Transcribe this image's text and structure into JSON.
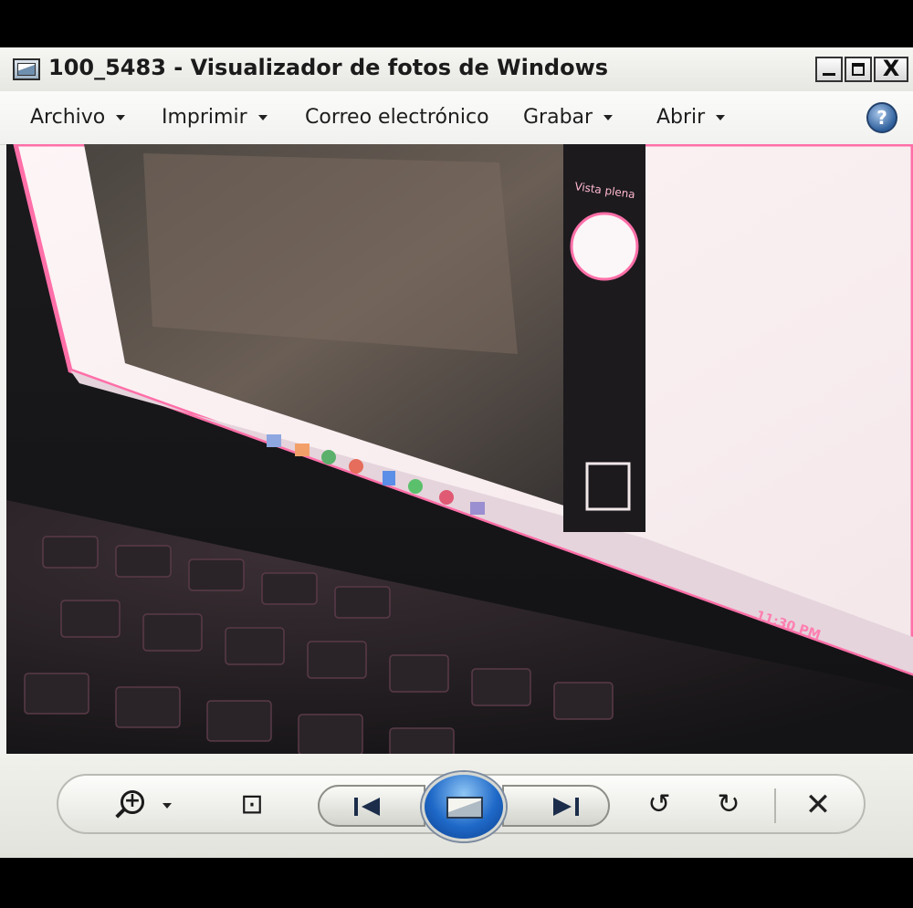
{
  "window": {
    "title": "100_5483 - Visualizador de fotos de Windows",
    "caption_buttons": {
      "close": "X"
    }
  },
  "menu": {
    "items": [
      {
        "label": "Archivo"
      },
      {
        "label": "Imprimir"
      },
      {
        "label": "Correo electrónico"
      },
      {
        "label": "Grabar"
      },
      {
        "label": "Abrir"
      }
    ],
    "help": "?"
  },
  "photo": {
    "on_screen_clock": "11:30 PM",
    "on_screen_label": "Vista plena"
  },
  "toolbar": {
    "zoom_glyph": "+",
    "actual_size_glyph": "⊡",
    "rotate_left_glyph": "↺",
    "rotate_right_glyph": "↻",
    "delete_glyph": "✕"
  },
  "colors": {
    "window_bg": "#f1f2ef",
    "slideshow_blue": "#1f69c8",
    "screen_pink": "#ff6fa8"
  }
}
